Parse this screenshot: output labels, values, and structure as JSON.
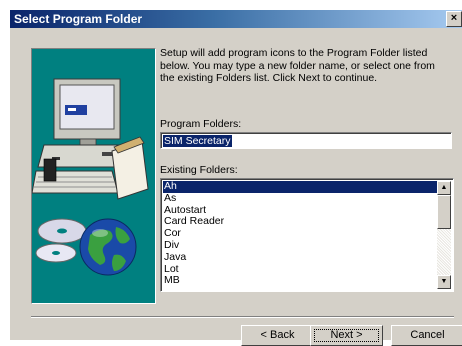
{
  "window": {
    "title": "Select Program Folder",
    "close_glyph": "×"
  },
  "description": "Setup will add program icons to the Program Folder listed below. You may type a new folder name, or select one from the existing Folders list.  Click Next to continue.",
  "program_folders": {
    "label": "Program Folders:",
    "value": "SIM Secretary"
  },
  "existing_folders": {
    "label": "Existing Folders:",
    "items": [
      "Ah",
      "As",
      "Autostart",
      "Card Reader",
      "Cor",
      "Div",
      "Java",
      "Lot",
      "MB"
    ],
    "selected_index": 0
  },
  "buttons": {
    "back": "< Back",
    "next": "Next >",
    "cancel": "Cancel"
  },
  "colors": {
    "title_bar": "#0a246a",
    "dialog_face": "#d4d0c8",
    "art_background": "#008080",
    "selection": "#0a246a"
  },
  "icons": {
    "art": "computer-with-cd-and-globe-illustration",
    "scroll_up": "scroll-up-arrow-icon",
    "scroll_down": "scroll-down-arrow-icon"
  }
}
